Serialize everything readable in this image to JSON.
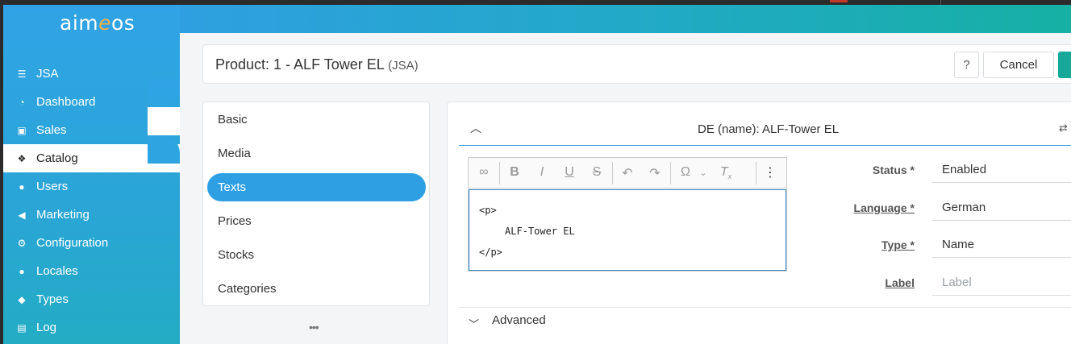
{
  "app": {
    "logo_text_a": "aim",
    "logo_text_e": "e",
    "logo_text_b": "os"
  },
  "sidebar": {
    "items": [
      {
        "label": "JSA",
        "icon": "list-icon"
      },
      {
        "label": "Dashboard",
        "icon": "dashboard-icon"
      },
      {
        "label": "Sales",
        "icon": "money-icon"
      },
      {
        "label": "Catalog",
        "icon": "cubes-icon",
        "active": true
      },
      {
        "label": "Users",
        "icon": "users-icon"
      },
      {
        "label": "Marketing",
        "icon": "bullhorn-icon"
      },
      {
        "label": "Configuration",
        "icon": "cogs-icon"
      },
      {
        "label": "Locales",
        "icon": "globe-icon"
      },
      {
        "label": "Types",
        "icon": "tag-icon"
      },
      {
        "label": "Log",
        "icon": "archive-icon"
      }
    ]
  },
  "header": {
    "title": "Product: 1 - ALF Tower EL",
    "code": "(JSA)",
    "help_label": "?",
    "cancel_label": "Cancel"
  },
  "tabs": {
    "items": [
      {
        "label": "Basic"
      },
      {
        "label": "Media"
      },
      {
        "label": "Texts",
        "active": true
      },
      {
        "label": "Prices"
      },
      {
        "label": "Stocks"
      },
      {
        "label": "Categories"
      }
    ],
    "more": "•••"
  },
  "text_item": {
    "section_title": "DE (name): ALF-Tower EL",
    "editor": {
      "line1": "<p>",
      "line2": "ALF-Tower EL",
      "line3": "</p>"
    },
    "fields": {
      "status": {
        "label": "Status *",
        "value": "Enabled"
      },
      "language": {
        "label": "Language *",
        "value": "German"
      },
      "type": {
        "label": "Type *",
        "value": "Name"
      },
      "label": {
        "label": "Label",
        "placeholder": "Label"
      }
    },
    "advanced_label": "Advanced"
  },
  "colors": {
    "accent": "#2f9fe3",
    "save": "#17a89a"
  }
}
